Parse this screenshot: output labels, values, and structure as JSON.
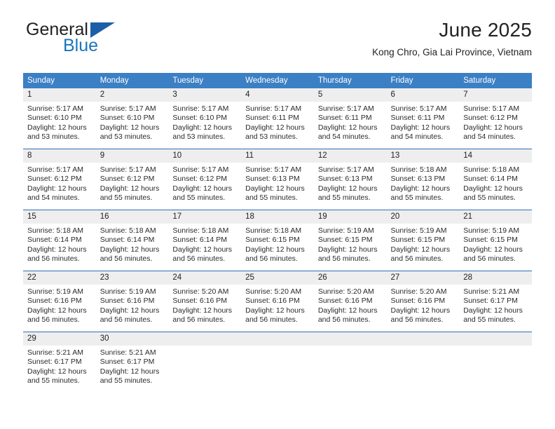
{
  "brand": {
    "name_part1": "General",
    "name_part2": "Blue",
    "accent_color": "#1b75bb",
    "triangle_color": "#1b5fa8"
  },
  "header": {
    "title": "June 2025",
    "subtitle": "Kong Chro, Gia Lai Province, Vietnam"
  },
  "calendar": {
    "header_color": "#3b7fc4",
    "daynum_background": "#eeeeee",
    "weekday_headers": [
      "Sunday",
      "Monday",
      "Tuesday",
      "Wednesday",
      "Thursday",
      "Friday",
      "Saturday"
    ],
    "weeks": [
      {
        "days": [
          {
            "num": "1",
            "sunrise": "Sunrise: 5:17 AM",
            "sunset": "Sunset: 6:10 PM",
            "daylight": "Daylight: 12 hours and 53 minutes."
          },
          {
            "num": "2",
            "sunrise": "Sunrise: 5:17 AM",
            "sunset": "Sunset: 6:10 PM",
            "daylight": "Daylight: 12 hours and 53 minutes."
          },
          {
            "num": "3",
            "sunrise": "Sunrise: 5:17 AM",
            "sunset": "Sunset: 6:10 PM",
            "daylight": "Daylight: 12 hours and 53 minutes."
          },
          {
            "num": "4",
            "sunrise": "Sunrise: 5:17 AM",
            "sunset": "Sunset: 6:11 PM",
            "daylight": "Daylight: 12 hours and 53 minutes."
          },
          {
            "num": "5",
            "sunrise": "Sunrise: 5:17 AM",
            "sunset": "Sunset: 6:11 PM",
            "daylight": "Daylight: 12 hours and 54 minutes."
          },
          {
            "num": "6",
            "sunrise": "Sunrise: 5:17 AM",
            "sunset": "Sunset: 6:11 PM",
            "daylight": "Daylight: 12 hours and 54 minutes."
          },
          {
            "num": "7",
            "sunrise": "Sunrise: 5:17 AM",
            "sunset": "Sunset: 6:12 PM",
            "daylight": "Daylight: 12 hours and 54 minutes."
          }
        ]
      },
      {
        "days": [
          {
            "num": "8",
            "sunrise": "Sunrise: 5:17 AM",
            "sunset": "Sunset: 6:12 PM",
            "daylight": "Daylight: 12 hours and 54 minutes."
          },
          {
            "num": "9",
            "sunrise": "Sunrise: 5:17 AM",
            "sunset": "Sunset: 6:12 PM",
            "daylight": "Daylight: 12 hours and 55 minutes."
          },
          {
            "num": "10",
            "sunrise": "Sunrise: 5:17 AM",
            "sunset": "Sunset: 6:12 PM",
            "daylight": "Daylight: 12 hours and 55 minutes."
          },
          {
            "num": "11",
            "sunrise": "Sunrise: 5:17 AM",
            "sunset": "Sunset: 6:13 PM",
            "daylight": "Daylight: 12 hours and 55 minutes."
          },
          {
            "num": "12",
            "sunrise": "Sunrise: 5:17 AM",
            "sunset": "Sunset: 6:13 PM",
            "daylight": "Daylight: 12 hours and 55 minutes."
          },
          {
            "num": "13",
            "sunrise": "Sunrise: 5:18 AM",
            "sunset": "Sunset: 6:13 PM",
            "daylight": "Daylight: 12 hours and 55 minutes."
          },
          {
            "num": "14",
            "sunrise": "Sunrise: 5:18 AM",
            "sunset": "Sunset: 6:14 PM",
            "daylight": "Daylight: 12 hours and 55 minutes."
          }
        ]
      },
      {
        "days": [
          {
            "num": "15",
            "sunrise": "Sunrise: 5:18 AM",
            "sunset": "Sunset: 6:14 PM",
            "daylight": "Daylight: 12 hours and 56 minutes."
          },
          {
            "num": "16",
            "sunrise": "Sunrise: 5:18 AM",
            "sunset": "Sunset: 6:14 PM",
            "daylight": "Daylight: 12 hours and 56 minutes."
          },
          {
            "num": "17",
            "sunrise": "Sunrise: 5:18 AM",
            "sunset": "Sunset: 6:14 PM",
            "daylight": "Daylight: 12 hours and 56 minutes."
          },
          {
            "num": "18",
            "sunrise": "Sunrise: 5:18 AM",
            "sunset": "Sunset: 6:15 PM",
            "daylight": "Daylight: 12 hours and 56 minutes."
          },
          {
            "num": "19",
            "sunrise": "Sunrise: 5:19 AM",
            "sunset": "Sunset: 6:15 PM",
            "daylight": "Daylight: 12 hours and 56 minutes."
          },
          {
            "num": "20",
            "sunrise": "Sunrise: 5:19 AM",
            "sunset": "Sunset: 6:15 PM",
            "daylight": "Daylight: 12 hours and 56 minutes."
          },
          {
            "num": "21",
            "sunrise": "Sunrise: 5:19 AM",
            "sunset": "Sunset: 6:15 PM",
            "daylight": "Daylight: 12 hours and 56 minutes."
          }
        ]
      },
      {
        "days": [
          {
            "num": "22",
            "sunrise": "Sunrise: 5:19 AM",
            "sunset": "Sunset: 6:16 PM",
            "daylight": "Daylight: 12 hours and 56 minutes."
          },
          {
            "num": "23",
            "sunrise": "Sunrise: 5:19 AM",
            "sunset": "Sunset: 6:16 PM",
            "daylight": "Daylight: 12 hours and 56 minutes."
          },
          {
            "num": "24",
            "sunrise": "Sunrise: 5:20 AM",
            "sunset": "Sunset: 6:16 PM",
            "daylight": "Daylight: 12 hours and 56 minutes."
          },
          {
            "num": "25",
            "sunrise": "Sunrise: 5:20 AM",
            "sunset": "Sunset: 6:16 PM",
            "daylight": "Daylight: 12 hours and 56 minutes."
          },
          {
            "num": "26",
            "sunrise": "Sunrise: 5:20 AM",
            "sunset": "Sunset: 6:16 PM",
            "daylight": "Daylight: 12 hours and 56 minutes."
          },
          {
            "num": "27",
            "sunrise": "Sunrise: 5:20 AM",
            "sunset": "Sunset: 6:16 PM",
            "daylight": "Daylight: 12 hours and 56 minutes."
          },
          {
            "num": "28",
            "sunrise": "Sunrise: 5:21 AM",
            "sunset": "Sunset: 6:17 PM",
            "daylight": "Daylight: 12 hours and 55 minutes."
          }
        ]
      },
      {
        "days": [
          {
            "num": "29",
            "sunrise": "Sunrise: 5:21 AM",
            "sunset": "Sunset: 6:17 PM",
            "daylight": "Daylight: 12 hours and 55 minutes."
          },
          {
            "num": "30",
            "sunrise": "Sunrise: 5:21 AM",
            "sunset": "Sunset: 6:17 PM",
            "daylight": "Daylight: 12 hours and 55 minutes."
          },
          {
            "num": "",
            "sunrise": "",
            "sunset": "",
            "daylight": ""
          },
          {
            "num": "",
            "sunrise": "",
            "sunset": "",
            "daylight": ""
          },
          {
            "num": "",
            "sunrise": "",
            "sunset": "",
            "daylight": ""
          },
          {
            "num": "",
            "sunrise": "",
            "sunset": "",
            "daylight": ""
          },
          {
            "num": "",
            "sunrise": "",
            "sunset": "",
            "daylight": ""
          }
        ]
      }
    ]
  }
}
